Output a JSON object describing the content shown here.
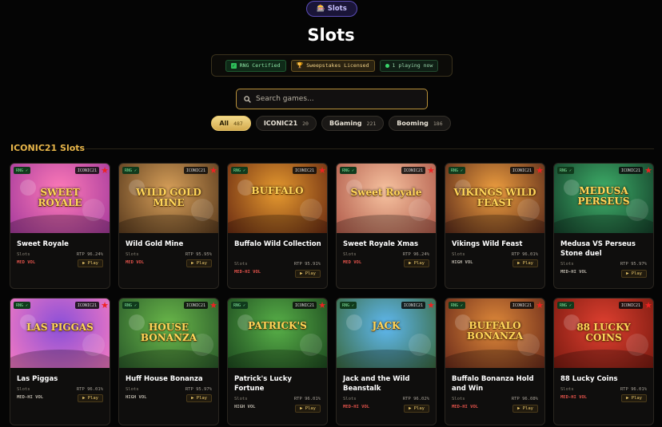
{
  "header": {
    "pill_label": "🎰 Slots",
    "title": "Slots",
    "badges": [
      {
        "label": "RNG Certified",
        "icon": "check-icon"
      },
      {
        "label": "Sweepstakes Licensed",
        "icon": "trophy-icon"
      },
      {
        "label": "1 playing now",
        "icon": "online-dot-icon"
      }
    ]
  },
  "search": {
    "placeholder": "Search games..."
  },
  "filters": [
    {
      "label": "All",
      "count": "487",
      "active": true
    },
    {
      "label": "ICONIC21",
      "count": "20"
    },
    {
      "label": "BGaming",
      "count": "221"
    },
    {
      "label": "Booming",
      "count": "186"
    }
  ],
  "section": {
    "title": "ICONIC21 Slots"
  },
  "card_common": {
    "rng_label": "RNG ✓",
    "provider_label": "ICONIC21",
    "category": "Slots",
    "play_label": "▶ Play"
  },
  "games": [
    {
      "name": "Sweet Royale",
      "rtp": "RTP 96.24%",
      "vol": "MED VOL",
      "vol_color": "#e0524a",
      "logo": "SWEET ROYALE"
    },
    {
      "name": "Wild Gold Mine",
      "rtp": "RTP 95.95%",
      "vol": "MED VOL",
      "vol_color": "#e0524a",
      "logo": "WILD GOLD MINE"
    },
    {
      "name": "Buffalo Wild Collection",
      "rtp": "RTP 95.91%",
      "vol": "MED-HI VOL",
      "vol_color": "#e0524a",
      "logo": "BUFFALO"
    },
    {
      "name": "Sweet Royale Xmas",
      "rtp": "RTP 96.24%",
      "vol": "MED VOL",
      "vol_color": "#e0524a",
      "logo": "Sweet Royale"
    },
    {
      "name": "Vikings Wild Feast",
      "rtp": "RTP 96.01%",
      "vol": "HIGH VOL",
      "vol_color": "#b9b3a8",
      "logo": "VIKINGS WILD FEAST"
    },
    {
      "name": "Medusa VS Perseus Stone duel",
      "rtp": "RTP 95.97%",
      "vol": "MED-HI VOL",
      "vol_color": "#b9b3a8",
      "logo": "MEDUSA PERSEUS"
    },
    {
      "name": "Las Piggas",
      "rtp": "RTP 96.01%",
      "vol": "MED-HI VOL",
      "vol_color": "#b9b3a8",
      "logo": "LAS PIGGAS"
    },
    {
      "name": "Huff House Bonanza",
      "rtp": "RTP 95.97%",
      "vol": "HIGH VOL",
      "vol_color": "#b9b3a8",
      "logo": "HOUSE BONANZA"
    },
    {
      "name": "Patrick's Lucky Fortune",
      "rtp": "RTP 96.01%",
      "vol": "HIGH VOL",
      "vol_color": "#b9b3a8",
      "logo": "PATRICK'S"
    },
    {
      "name": "Jack and the Wild Beanstalk",
      "rtp": "RTP 96.02%",
      "vol": "MED-HI VOL",
      "vol_color": "#e0524a",
      "logo": "JACK"
    },
    {
      "name": "Buffalo Bonanza Hold and Win",
      "rtp": "RTP 96.08%",
      "vol": "MED-HI VOL",
      "vol_color": "#e0524a",
      "logo": "BUFFALO BONANZA"
    },
    {
      "name": "88 Lucky Coins",
      "rtp": "RTP 96.01%",
      "vol": "MED-HI VOL",
      "vol_color": "#e0524a",
      "logo": "88 LUCKY COINS"
    }
  ],
  "colors": {
    "accent_gold": "#e8b64a",
    "background": "#050505",
    "rng_green": "#7fe39b",
    "pill_purple": "#5b4db8"
  }
}
